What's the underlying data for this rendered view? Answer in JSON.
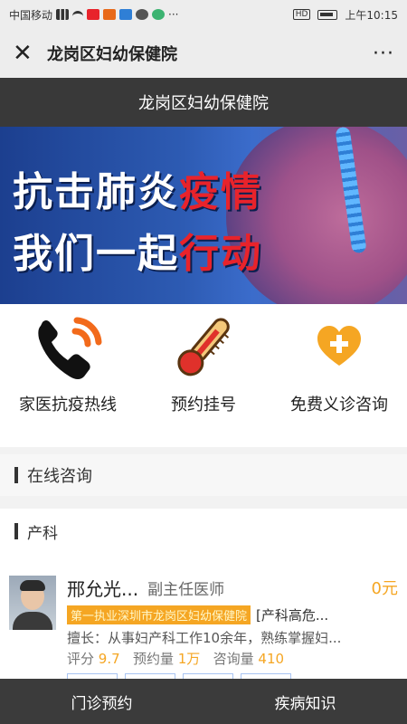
{
  "status_bar": {
    "carrier": "中国移动",
    "time": "上午10:15",
    "hd": "HD",
    "dots": "···"
  },
  "wechat_header": {
    "title": "龙岗区妇幼保健院",
    "close_icon": "close-icon",
    "more_label": "···"
  },
  "page": {
    "title": "龙岗区妇幼保健院"
  },
  "banner": {
    "line1_white": "抗击肺炎",
    "line1_red": "疫情",
    "line2_white": "我们一起",
    "line2_red": "行动",
    "colors": {
      "bg": "#2d5bb3",
      "accent": "#e8232b"
    }
  },
  "actions": [
    {
      "label": "家医抗疫热线",
      "icon": "phone-icon"
    },
    {
      "label": "预约挂号",
      "icon": "thermometer-icon"
    },
    {
      "label": "免费义诊咨询",
      "icon": "heart-plus-icon"
    }
  ],
  "sections": {
    "online": "在线咨询",
    "obstetrics": "产科"
  },
  "doctor": {
    "name": "邢允光...",
    "title": "副主任医师",
    "price": "0元",
    "hospital_tag": "第一执业深圳市龙岗区妇幼保健院",
    "subtag": "[产科高危...",
    "description": "擅长：从事妇产科工作10余年，熟练掌握妇...",
    "rating_label": "评分",
    "rating": "9.7",
    "appointments_label": "预约量",
    "appointments": "1万",
    "consults_label": "咨询量",
    "consults": "410"
  },
  "bottom_nav": {
    "tab1": "门诊预约",
    "tab2": "疾病知识"
  }
}
